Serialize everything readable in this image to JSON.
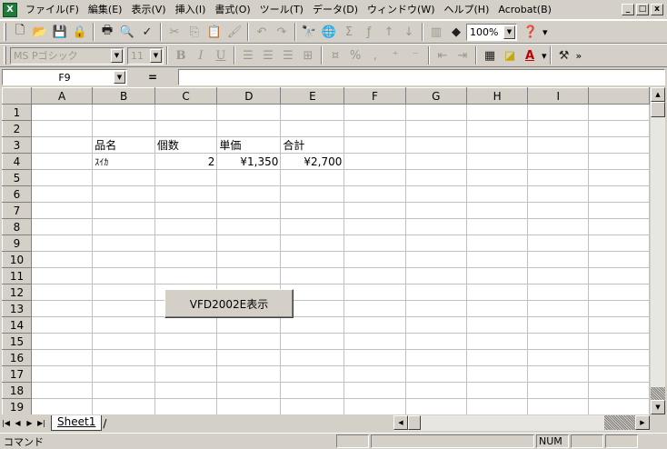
{
  "menu": {
    "items": [
      "ファイル(F)",
      "編集(E)",
      "表示(V)",
      "挿入(I)",
      "書式(O)",
      "ツール(T)",
      "データ(D)",
      "ウィンドウ(W)",
      "ヘルプ(H)",
      "Acrobat(B)"
    ],
    "window_controls": [
      "_",
      "□",
      "x"
    ]
  },
  "toolbar_standard": {
    "zoom": "100%"
  },
  "toolbar_format": {
    "font_name": "MS Pゴシック",
    "font_size": "11",
    "bold": "B",
    "italic": "I",
    "underline": "U"
  },
  "formula_bar": {
    "name_box": "F9",
    "equals": "="
  },
  "grid": {
    "columns": [
      "A",
      "B",
      "C",
      "D",
      "E",
      "F",
      "G",
      "H",
      "I"
    ],
    "rows": [
      "1",
      "2",
      "3",
      "4",
      "5",
      "6",
      "7",
      "8",
      "9",
      "10",
      "11",
      "12",
      "13",
      "14",
      "15",
      "16",
      "17",
      "18",
      "19"
    ],
    "cells": {
      "B3": "品名",
      "C3": "個数",
      "D3": "単価",
      "E3": "合計",
      "B4": "ｽｲｶ",
      "C4": "2",
      "D4": "¥1,350",
      "E4": "¥2,700"
    }
  },
  "vba_button": {
    "label": "VFD2002E表示"
  },
  "sheet_tabs": {
    "active": "Sheet1"
  },
  "status": {
    "text": "コマンド",
    "num": "NUM"
  }
}
